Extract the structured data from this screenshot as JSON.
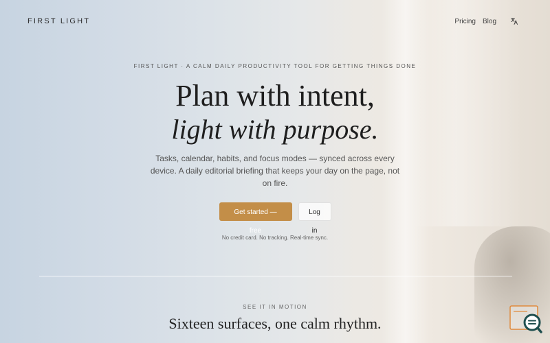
{
  "header": {
    "brand": "FIRST LIGHT",
    "nav": [
      {
        "label": "Pricing"
      },
      {
        "label": "Blog"
      }
    ],
    "language_icon": "translate-icon"
  },
  "hero": {
    "eyebrow": "FIRST LIGHT · A CALM DAILY PRODUCTIVITY TOOL FOR GETTING THINGS DONE",
    "headline_line1": "Plan with intent,",
    "headline_line2": "light with purpose.",
    "lede": "Tasks, calendar, habits, and focus modes — synced across every device. A daily editorial briefing that keeps your day on the page, not on fire.",
    "primary_cta": "Get started — free",
    "secondary_cta": "Log in",
    "fineprint": "No credit card. No tracking. Real-time sync."
  },
  "motion_section": {
    "eyebrow": "SEE IT IN MOTION",
    "title": "Sixteen surfaces, one calm rhythm."
  },
  "floating_widget": {
    "icon": "search-chat-icon"
  },
  "colors": {
    "accent": "#c38e48",
    "text": "#1e1e1e"
  }
}
